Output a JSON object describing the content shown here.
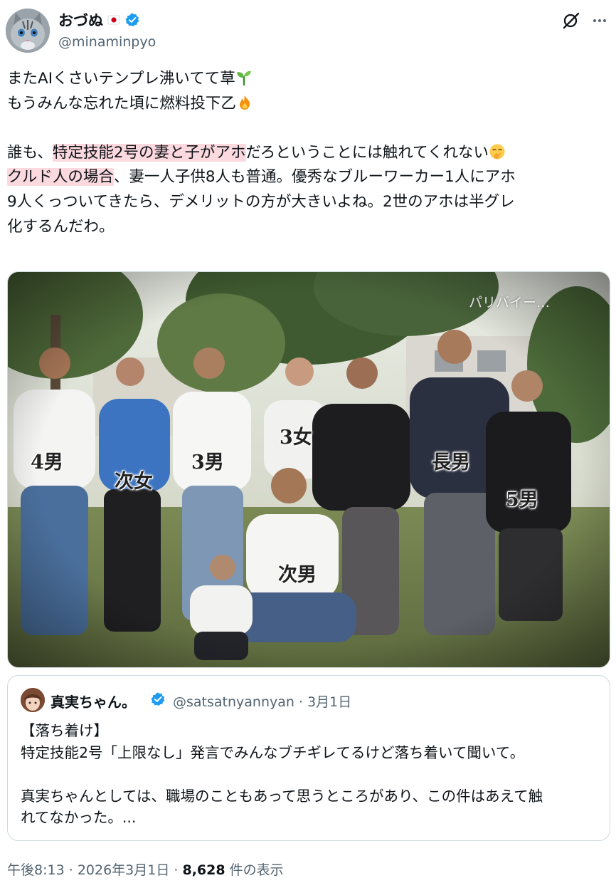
{
  "author": {
    "display_name": "おづぬ",
    "handle": "@minaminpyo",
    "verified": true,
    "flag_icon": "japan-flag-icon",
    "avatar_icon": "cat-avatar"
  },
  "header_actions": {
    "grok_icon": "grok-icon",
    "more_icon": "more-dots-icon"
  },
  "tweet": {
    "line1": "またAIくさいテンプレ沸いてて草",
    "line2": "もうみんな忘れた頃に燃料投下乙",
    "line3_pre": "誰も、",
    "line3_hl": "特定技能2号の妻と子がアホ",
    "line3_post": "だろということには触れてくれない",
    "line4_hl": "クルド人の場合",
    "line4_post": "、妻一人子供8人も普通。優秀なブルーワーカー1人にアホ",
    "line5": "9人くっついてきたら、デメリットの方が大きいよね。2世のアホは半グレ",
    "line6": "化するんだわ。",
    "highlight_color": "#fbd9de"
  },
  "photo": {
    "caption": "パリバイー…",
    "labels": {
      "son4": "4男",
      "daughter2": "次女",
      "son3": "3男",
      "daughter3": "3女",
      "son1": "長男",
      "son5": "5男",
      "son2": "次男"
    }
  },
  "quote": {
    "display_name": "真実ちゃん。",
    "handle": "@satsatnyannyan",
    "date": "3月1日",
    "separator": "·",
    "line1": "【落ち着け】",
    "line2": "特定技能2号「上限なし」発言でみんなブチギレてるけど落ち着いて聞いて。",
    "line3": "真実ちゃんとしては、職場のこともあって思うところがあり、この件はあえて触",
    "line4": "れてなかった。..."
  },
  "footer": {
    "time": "午後8:13",
    "date": "2026年3月1日",
    "views": "8,628",
    "views_suffix": "件の表示",
    "separator": "·"
  },
  "colors": {
    "verified_blue": "#1d9bf0",
    "text_primary": "#0f1419",
    "text_secondary": "#536471",
    "border": "#cfd9de"
  }
}
